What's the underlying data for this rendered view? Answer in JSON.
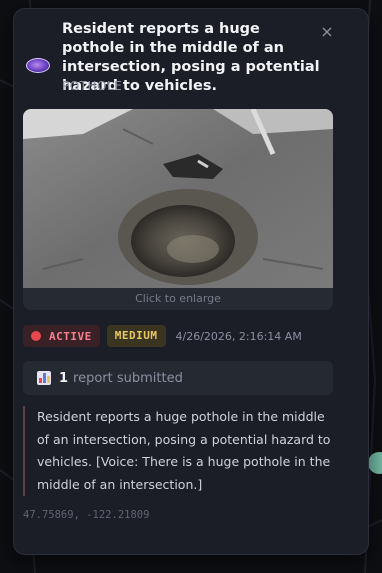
{
  "report": {
    "title": "Resident reports a huge pothole in the middle of an intersection, posing a potential hazard to vehicles.",
    "subtype": "POTHOLE",
    "close_symbol": "×",
    "photo_caption": "Click to enlarge",
    "status": "ACTIVE",
    "severity": "MEDIUM",
    "timestamp": "4/26/2026, 2:16:14 AM",
    "report_count": "1",
    "report_label": "report submitted",
    "description": "Resident reports a huge pothole in the middle of an intersection, posing a potential hazard to vehicles. [Voice: There is a huge pothole in the middle of an intersection.]",
    "coordinates": "47.75869, -122.21809"
  },
  "colors": {
    "card_bg": "#1b1e26",
    "status_active": "#e5484d",
    "severity_medium": "#e8c766",
    "map_marker": "#7fd1b9"
  },
  "icons": [
    "pothole-type-icon",
    "close-icon",
    "status-dot-icon",
    "bar-chart-icon"
  ]
}
